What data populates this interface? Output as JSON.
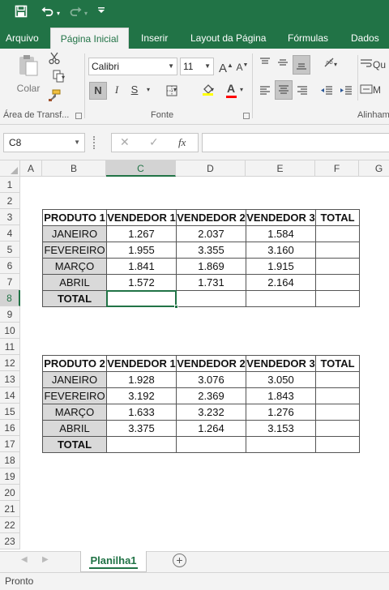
{
  "quick_access": {
    "save_icon": "save-icon",
    "undo_icon": "undo-icon",
    "redo_icon": "redo-icon",
    "customize_icon": "customize-icon"
  },
  "tabs": [
    "Arquivo",
    "Página Inicial",
    "Inserir",
    "Layout da Página",
    "Fórmulas",
    "Dados"
  ],
  "active_tab": "Página Inicial",
  "ribbon": {
    "paste_label": "Colar",
    "clipboard_group": "Área de Transf...",
    "font_name": "Calibri",
    "font_size": "11",
    "bold": "N",
    "italic": "I",
    "underline": "S",
    "font_group": "Fonte",
    "alignment_group": "Alinham",
    "font_color": "#ff0000",
    "highlight_color": "#ffff00"
  },
  "formula_bar": {
    "name_box": "C8",
    "fx": "fx",
    "formula": ""
  },
  "columns": [
    "A",
    "B",
    "C",
    "D",
    "E",
    "F",
    "G"
  ],
  "selected_column": "C",
  "rows": [
    "1",
    "2",
    "3",
    "4",
    "5",
    "6",
    "7",
    "8",
    "9",
    "10",
    "11",
    "12",
    "13",
    "14",
    "15",
    "16",
    "17",
    "18",
    "19",
    "20",
    "21",
    "22",
    "23"
  ],
  "selected_row": "8",
  "table1": {
    "headers": [
      "PRODUTO 1",
      "VENDEDOR 1",
      "VENDEDOR 2",
      "VENDEDOR 3",
      "TOTAL"
    ],
    "rows": [
      [
        "JANEIRO",
        "1.267",
        "2.037",
        "1.584",
        ""
      ],
      [
        "FEVEREIRO",
        "1.955",
        "3.355",
        "3.160",
        ""
      ],
      [
        "MARÇO",
        "1.841",
        "1.869",
        "1.915",
        ""
      ],
      [
        "ABRIL",
        "1.572",
        "1.731",
        "2.164",
        ""
      ],
      [
        "TOTAL",
        "",
        "",
        "",
        ""
      ]
    ]
  },
  "table2": {
    "headers": [
      "PRODUTO 2",
      "VENDEDOR 1",
      "VENDEDOR 2",
      "VENDEDOR 3",
      "TOTAL"
    ],
    "rows": [
      [
        "JANEIRO",
        "1.928",
        "3.076",
        "3.050",
        ""
      ],
      [
        "FEVEREIRO",
        "3.192",
        "2.369",
        "1.843",
        ""
      ],
      [
        "MARÇO",
        "1.633",
        "3.232",
        "1.276",
        ""
      ],
      [
        "ABRIL",
        "3.375",
        "1.264",
        "3.153",
        ""
      ],
      [
        "TOTAL",
        "",
        "",
        "",
        ""
      ]
    ]
  },
  "sheet_tab": "Planilha1",
  "status": "Pronto",
  "accent_color": "#217346"
}
